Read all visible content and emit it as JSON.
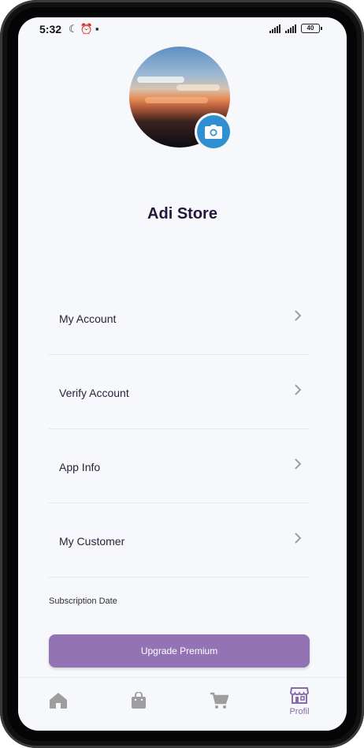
{
  "status_bar": {
    "time": "5:32",
    "battery": "40"
  },
  "profile": {
    "store_name": "Adi Store"
  },
  "menu": [
    {
      "label": "My Account"
    },
    {
      "label": "Verify Account"
    },
    {
      "label": "App Info"
    },
    {
      "label": "My Customer"
    }
  ],
  "subscription": {
    "label": "Subscription Date"
  },
  "upgrade": {
    "label": "Upgrade Premium"
  },
  "bottom_nav": {
    "items": [
      {
        "icon": "home-icon",
        "label": ""
      },
      {
        "icon": "shopping-bag-icon",
        "label": ""
      },
      {
        "icon": "cart-icon",
        "label": ""
      },
      {
        "icon": "store-icon",
        "label": "Profil"
      }
    ],
    "active_index": 3
  },
  "colors": {
    "accent": "#9373b4",
    "camera_button": "#2f8fd0",
    "title": "#24173a",
    "icon_inactive": "#9e9e9e",
    "icon_active": "#8a6aaa"
  }
}
